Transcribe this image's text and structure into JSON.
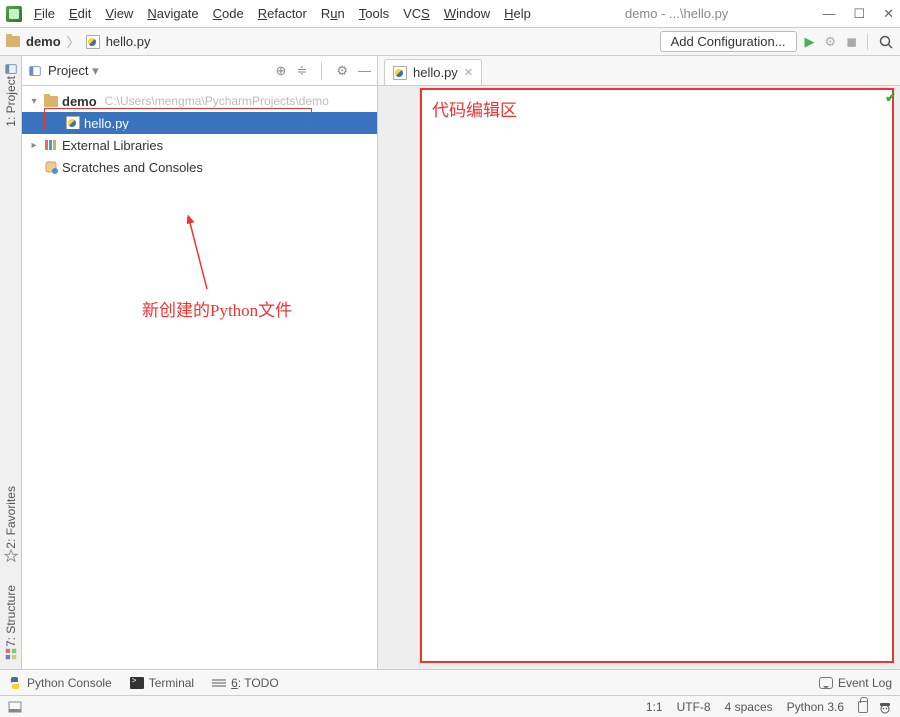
{
  "window": {
    "title": "demo - ...\\hello.py",
    "menu": [
      "File",
      "Edit",
      "View",
      "Navigate",
      "Code",
      "Refactor",
      "Run",
      "Tools",
      "VCS",
      "Window",
      "Help"
    ]
  },
  "toolbar": {
    "crumb_project": "demo",
    "crumb_file": "hello.py",
    "add_configuration": "Add Configuration..."
  },
  "project": {
    "panel_label": "Project",
    "root_name": "demo",
    "root_path": "C:\\Users\\mengma\\PycharmProjects\\demo",
    "file_name": "hello.py",
    "external_libs": "External Libraries",
    "scratches": "Scratches and Consoles"
  },
  "sidetabs": {
    "project": "1: Project",
    "favorites": "2: Favorites",
    "structure": "7: Structure"
  },
  "editor": {
    "tab_file": "hello.py",
    "annotation": "代码编辑区"
  },
  "annotations": {
    "new_file": "新创建的Python文件"
  },
  "bottom": {
    "python_console": "Python Console",
    "terminal": "Terminal",
    "todo": "6: TODO",
    "event_log": "Event Log"
  },
  "status": {
    "position": "1:1",
    "encoding": "UTF-8",
    "indent": "4 spaces",
    "interpreter": "Python 3.6"
  }
}
